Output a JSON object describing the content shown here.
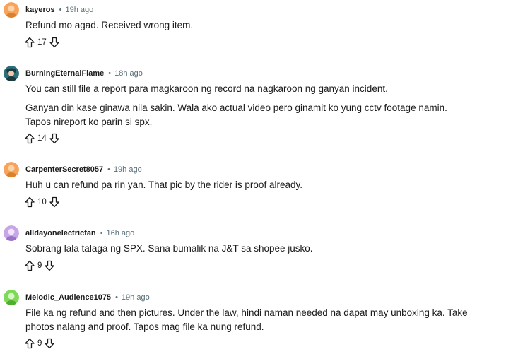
{
  "comments": [
    {
      "author": "kayeros",
      "time": "19h ago",
      "paragraphs": [
        "Refund mo agad. Received wrong item."
      ],
      "votes": "17",
      "avatar": {
        "bg": "#f7a35c",
        "face": "#d9822b"
      }
    },
    {
      "author": "BurningEternalFlame",
      "time": "18h ago",
      "paragraphs": [
        "You can still file a report para magkaroon ng record na nagkaroon ng ganyan incident.",
        "Ganyan din kase ginawa nila sakin. Wala ako actual video pero ginamit ko yung cctv footage namin. Tapos nireport ko parin si spx."
      ],
      "votes": "14",
      "avatar": {
        "bg": "#2c6e7a",
        "face": "#1d3a40"
      }
    },
    {
      "author": "CarpenterSecret8057",
      "time": "19h ago",
      "paragraphs": [
        "Huh u can refund pa rin yan. That pic by the rider is proof already."
      ],
      "votes": "10",
      "avatar": {
        "bg": "#f7a35c",
        "face": "#d9822b"
      }
    },
    {
      "author": "alldayonelectricfan",
      "time": "16h ago",
      "paragraphs": [
        "Sobrang lala talaga ng SPX. Sana bumalik na J&T sa shopee jusko."
      ],
      "votes": "9",
      "avatar": {
        "bg": "#c7a6e8",
        "face": "#9b72c9"
      }
    },
    {
      "author": "Melodic_Audience1075",
      "time": "19h ago",
      "paragraphs": [
        "File ka ng refund and then pictures. Under the law, hindi naman needed na dapat may unboxing ka. Take photos nalang and proof. Tapos mag file ka nung refund."
      ],
      "votes": "9",
      "avatar": {
        "bg": "#7ed957",
        "face": "#4fae2f"
      }
    }
  ],
  "icons": {
    "upvote": "upvote-arrow-icon",
    "downvote": "downvote-arrow-icon",
    "separator": "•"
  }
}
